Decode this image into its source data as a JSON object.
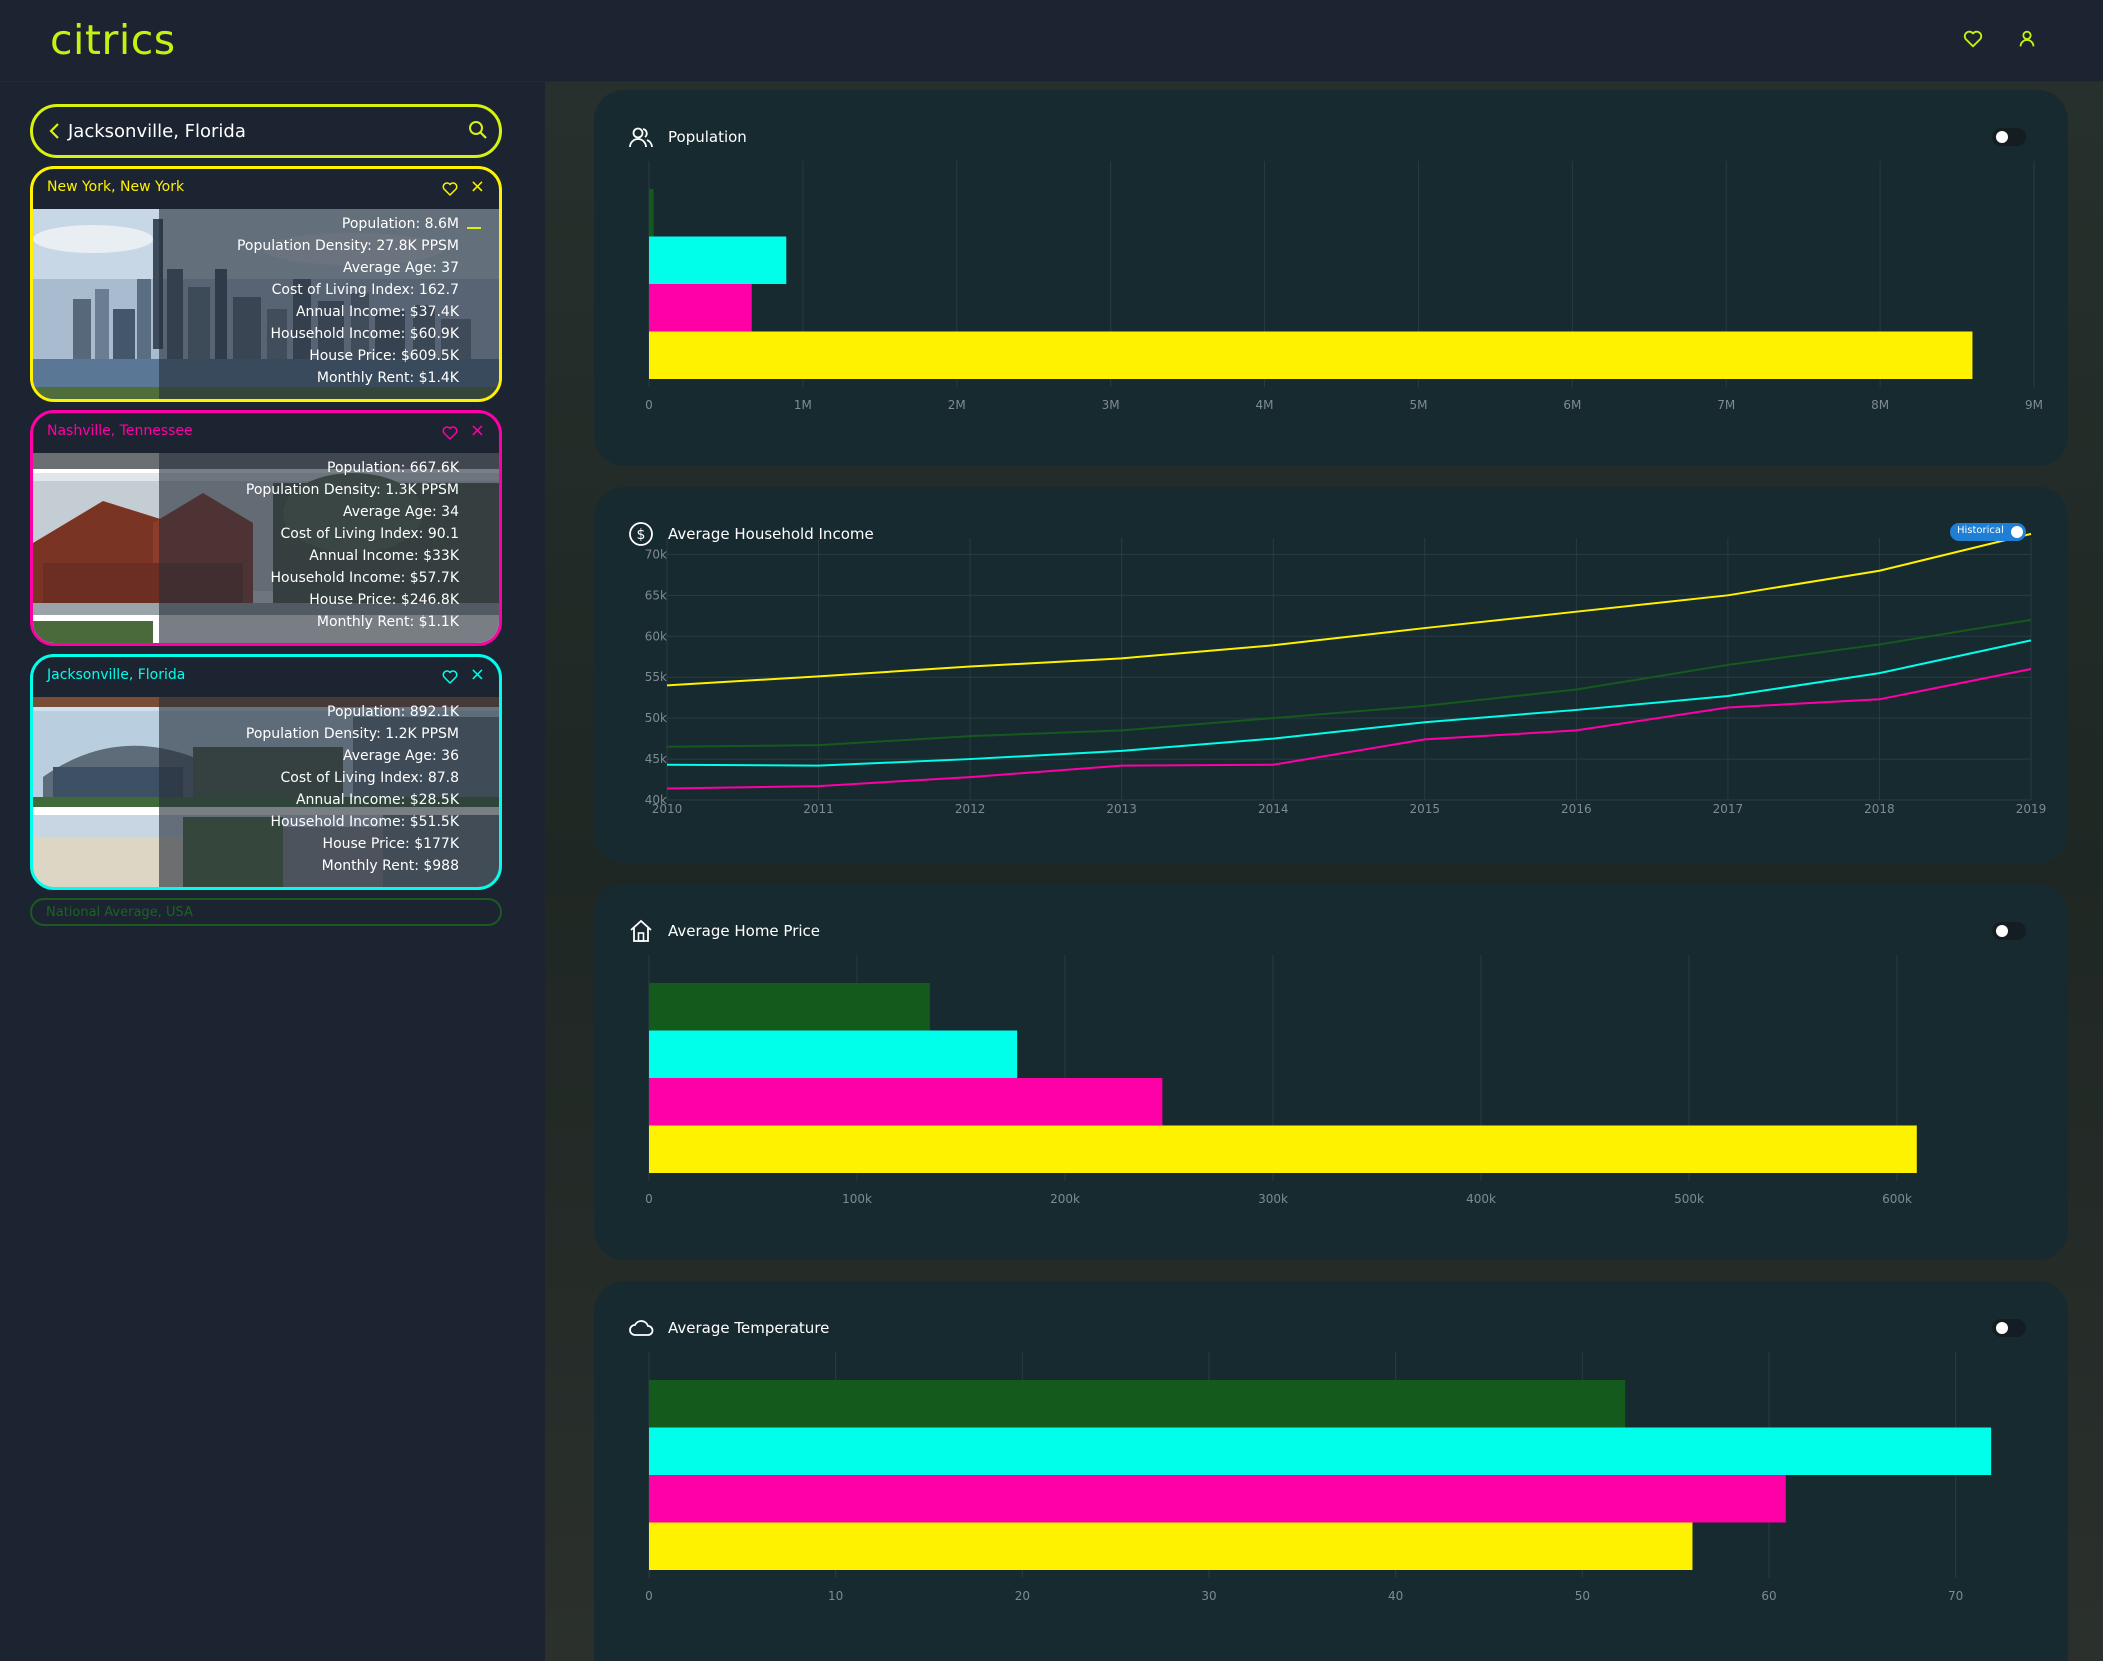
{
  "app": {
    "name": "citrics"
  },
  "header": {
    "favorites_icon": "heart-icon",
    "profile_icon": "user-icon"
  },
  "search": {
    "value": "Jacksonville, Florida",
    "back_icon": "chevron-left-icon",
    "search_icon": "search-icon"
  },
  "colors": {
    "accent": "#c6f211",
    "new_york": "#fff200",
    "nashville": "#ff00a6",
    "jacksonville": "#00ffea",
    "national": "#145a1d"
  },
  "cities": [
    {
      "name": "New York, New York",
      "color": "#fff200",
      "stats": [
        "Population: 8.6M",
        "Population Density: 27.8K PPSM",
        "Average Age: 37",
        "Cost of Living Index: 162.7",
        "Annual Income: $37.4K",
        "Household Income: $60.9K",
        "House Price: $609.5K",
        "Monthly Rent: $1.4K"
      ]
    },
    {
      "name": "Nashville, Tennessee",
      "color": "#ff00a6",
      "stats": [
        "Population: 667.6K",
        "Population Density: 1.3K PPSM",
        "Average Age: 34",
        "Cost of Living Index: 90.1",
        "Annual Income: $33K",
        "Household Income: $57.7K",
        "House Price: $246.8K",
        "Monthly Rent: $1.1K"
      ]
    },
    {
      "name": "Jacksonville, Florida",
      "color": "#00ffea",
      "stats": [
        "Population: 892.1K",
        "Population Density: 1.2K PPSM",
        "Average Age: 36",
        "Cost of Living Index: 87.8",
        "Annual Income: $28.5K",
        "Household Income: $51.5K",
        "House Price: $177K",
        "Monthly Rent: $988"
      ]
    }
  ],
  "national_average": {
    "label": "National Average, USA"
  },
  "panels": {
    "population": {
      "title": "Population",
      "icon": "people-icon"
    },
    "income": {
      "title": "Average Household Income",
      "icon": "dollar-icon",
      "toggle_label": "Historical"
    },
    "home": {
      "title": "Average Home Price",
      "icon": "home-icon"
    },
    "temp": {
      "title": "Average Temperature",
      "icon": "cloud-icon"
    }
  },
  "chart_data": [
    {
      "type": "bar",
      "orientation": "horizontal",
      "title": "Population",
      "xlim": [
        0,
        9000000
      ],
      "ticks": [
        "0",
        "1M",
        "2M",
        "3M",
        "4M",
        "5M",
        "6M",
        "7M",
        "8M",
        "9M"
      ],
      "tick_values": [
        0,
        1000000,
        2000000,
        3000000,
        4000000,
        5000000,
        6000000,
        7000000,
        8000000,
        9000000
      ],
      "bars": [
        {
          "color": "#145a1d",
          "value": 30000
        },
        {
          "color": "#00ffea",
          "value": 892100
        },
        {
          "color": "#ff00a6",
          "value": 667600
        },
        {
          "color": "#fff200",
          "value": 8600000
        }
      ]
    },
    {
      "type": "line",
      "title": "Average Household Income",
      "x": [
        2010,
        2011,
        2012,
        2013,
        2014,
        2015,
        2016,
        2017,
        2018,
        2019
      ],
      "ylim": [
        40000,
        72000
      ],
      "yticks": [
        "40k",
        "45k",
        "50k",
        "55k",
        "60k",
        "65k",
        "70k"
      ],
      "ytick_values": [
        40000,
        45000,
        50000,
        55000,
        60000,
        65000,
        70000
      ],
      "series": [
        {
          "color": "#fff200",
          "values": [
            54000,
            55100,
            56300,
            57300,
            58900,
            61000,
            63000,
            65000,
            68000,
            72500
          ]
        },
        {
          "color": "#145a1d",
          "values": [
            46500,
            46700,
            47800,
            48500,
            50000,
            51500,
            53500,
            56500,
            59000,
            62000
          ]
        },
        {
          "color": "#00ffea",
          "values": [
            44300,
            44200,
            45000,
            46000,
            47500,
            49500,
            51000,
            52700,
            55500,
            59500
          ]
        },
        {
          "color": "#ff00a6",
          "values": [
            41400,
            41700,
            42800,
            44200,
            44300,
            47400,
            48500,
            51300,
            52300,
            56000
          ]
        }
      ]
    },
    {
      "type": "bar",
      "orientation": "horizontal",
      "title": "Average Home Price",
      "xlim": [
        0,
        637000
      ],
      "ticks": [
        "0",
        "100k",
        "200k",
        "300k",
        "400k",
        "500k",
        "600k"
      ],
      "tick_values": [
        0,
        100000,
        200000,
        300000,
        400000,
        500000,
        600000
      ],
      "bars": [
        {
          "color": "#145a1d",
          "value": 135000
        },
        {
          "color": "#00ffea",
          "value": 177000
        },
        {
          "color": "#ff00a6",
          "value": 246800
        },
        {
          "color": "#fff200",
          "value": 609500
        }
      ]
    },
    {
      "type": "bar",
      "orientation": "horizontal",
      "title": "Average Temperature",
      "xlim": [
        0,
        75
      ],
      "ticks": [
        "0",
        "10",
        "20",
        "30",
        "40",
        "50",
        "60",
        "70"
      ],
      "tick_values": [
        0,
        10,
        20,
        30,
        40,
        50,
        60,
        70
      ],
      "bars": [
        {
          "color": "#145a1d",
          "value": 52.3
        },
        {
          "color": "#00ffea",
          "value": 71.9
        },
        {
          "color": "#ff00a6",
          "value": 60.9
        },
        {
          "color": "#fff200",
          "value": 55.9
        }
      ]
    }
  ]
}
